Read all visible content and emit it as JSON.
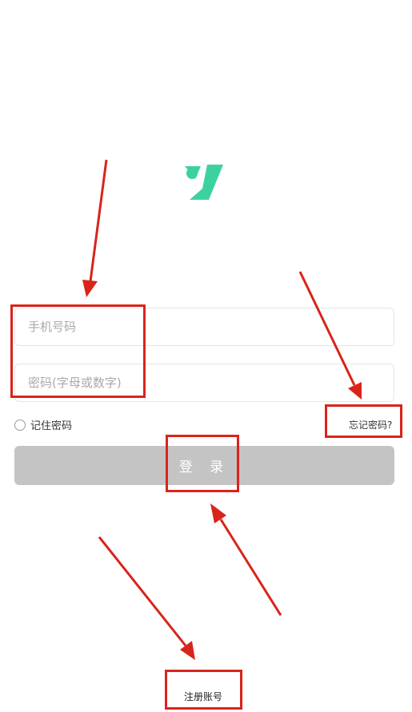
{
  "login": {
    "phone_placeholder": "手机号码",
    "password_placeholder": "密码(字母或数字)",
    "remember_label": "记住密码",
    "forgot_label": "忘记密码?",
    "login_label": "登 录",
    "register_label": "注册账号"
  },
  "colors": {
    "brand": "#3cd2a0",
    "login_button_bg": "#c4c4c4",
    "annotation": "#d9241b"
  },
  "icons": {
    "logo": "y-logo-icon"
  }
}
